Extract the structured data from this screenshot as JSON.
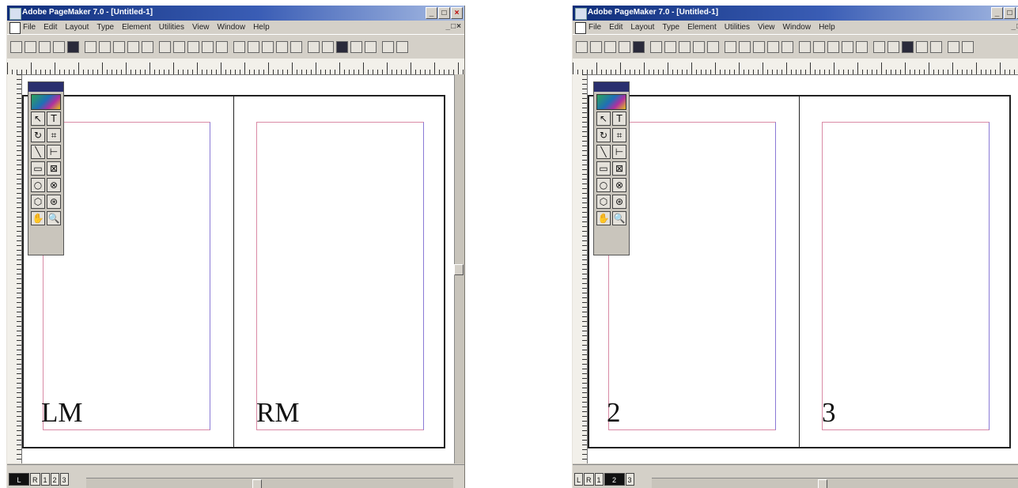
{
  "windows": [
    {
      "title": "Adobe PageMaker 7.0 - [Untitled-1]",
      "menu": [
        "File",
        "Edit",
        "Layout",
        "Type",
        "Element",
        "Utilities",
        "View",
        "Window",
        "Help"
      ],
      "pages": [
        {
          "label": "LM"
        },
        {
          "label": "RM"
        }
      ],
      "page_icons": [
        "L",
        "R",
        "1",
        "2",
        "3"
      ]
    },
    {
      "title": "Adobe PageMaker 7.0 - [Untitled-1]",
      "menu": [
        "File",
        "Edit",
        "Layout",
        "Type",
        "Element",
        "Utilities",
        "View",
        "Window",
        "Help"
      ],
      "pages": [
        {
          "label": "2"
        },
        {
          "label": "3"
        }
      ],
      "page_icons": [
        "L",
        "R",
        "1",
        "2",
        "3"
      ]
    }
  ],
  "window_buttons": {
    "minimize": "_",
    "maximize": "□",
    "close": "×"
  },
  "toolbox_tools": [
    "pointer-tool",
    "text-tool",
    "rotate-tool",
    "crop-tool",
    "line-tool",
    "constrained-line-tool",
    "rectangle-tool",
    "rectangle-frame-tool",
    "ellipse-tool",
    "ellipse-frame-tool",
    "polygon-tool",
    "polygon-frame-tool",
    "hand-tool",
    "zoom-tool"
  ],
  "colors": {
    "title_bar": "#0f2e7a",
    "margin_guide": "#d98aa5",
    "column_guide": "#8a7ad6",
    "chrome": "#d4d0c8"
  }
}
